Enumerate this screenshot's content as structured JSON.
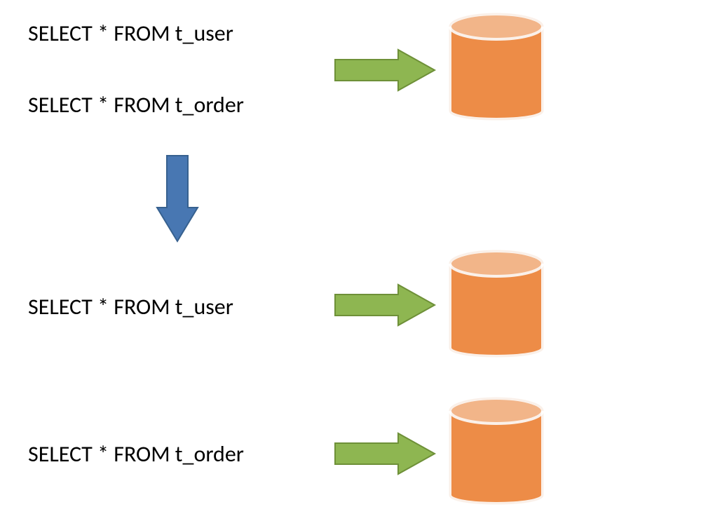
{
  "queries": {
    "top1": "SELECT * FROM t_user",
    "top2": "SELECT * FROM t_order",
    "mid": "SELECT * FROM t_user",
    "bot": "SELECT * FROM t_order"
  },
  "colors": {
    "arrow_green_fill": "#8EB651",
    "arrow_green_stroke": "#6E9038",
    "arrow_blue_fill": "#4877B2",
    "arrow_blue_stroke": "#37618F",
    "db_body": "#ED8C47",
    "db_stroke": "#CC6A26",
    "db_top_light": "#F2B589"
  }
}
